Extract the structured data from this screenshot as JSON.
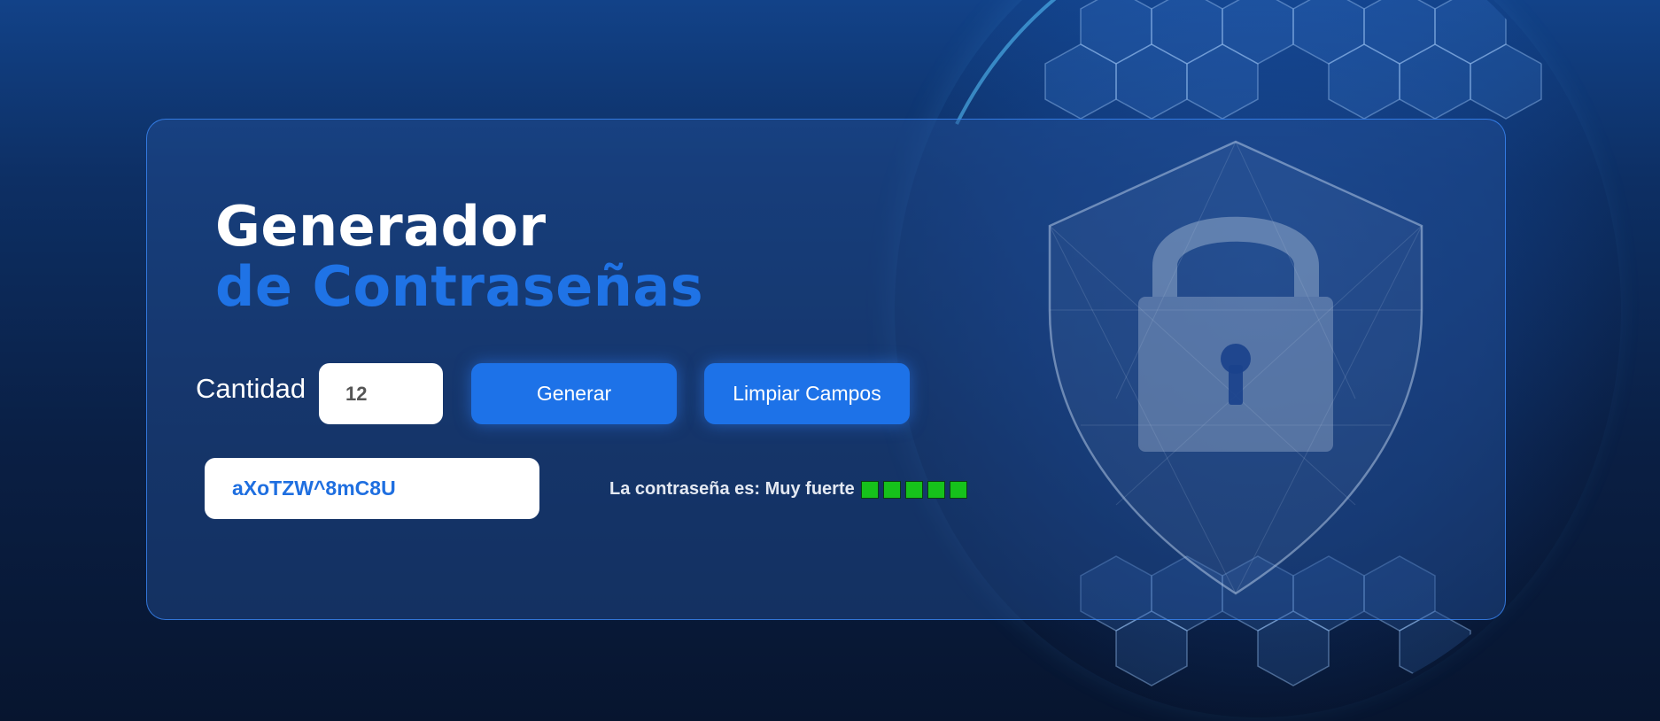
{
  "title": {
    "line1": "Generador",
    "line2": "de Contraseñas"
  },
  "quantity": {
    "label": "Cantidad",
    "value": "12"
  },
  "buttons": {
    "generate": "Generar",
    "clear": "Limpiar Campos"
  },
  "password": {
    "value": "aXoTZW^8mC8U"
  },
  "strength": {
    "text": "La contraseña es: Muy fuerte",
    "level": 5,
    "max": 5,
    "color": "#16c21b"
  },
  "colors": {
    "accent": "#1d72e8",
    "background_top": "#124288",
    "background_bottom": "#07152f",
    "card_border": "#3c8cff"
  },
  "icons": [
    "globe-hexagon-icon",
    "shield-lock-icon"
  ]
}
